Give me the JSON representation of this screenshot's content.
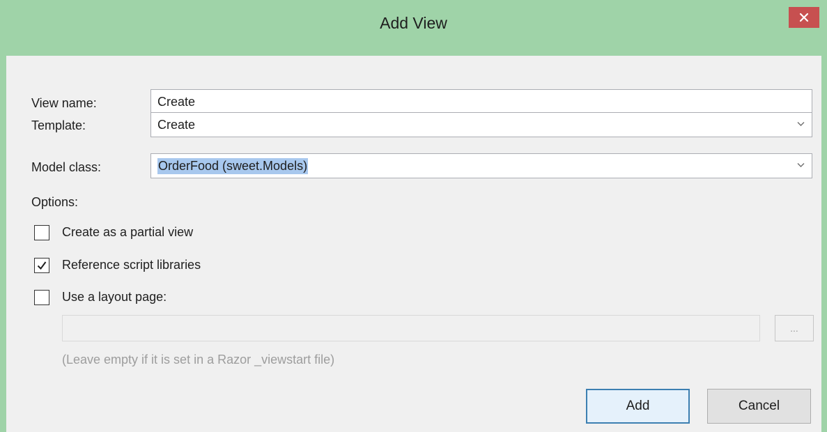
{
  "window": {
    "title": "Add View",
    "close_icon": "close-icon"
  },
  "form": {
    "view_name_label": "View name:",
    "view_name_value": "Create",
    "template_label": "Template:",
    "template_value": "Create",
    "model_class_label": "Model class:",
    "model_class_value": "OrderFood (sweet.Models)"
  },
  "options": {
    "label": "Options:",
    "partial_view": {
      "label": "Create as a partial view",
      "checked": false
    },
    "reference_scripts": {
      "label": "Reference script libraries",
      "checked": true
    },
    "layout_page": {
      "label": "Use a layout page:",
      "checked": false
    },
    "layout_path_value": "",
    "browse_label": "...",
    "hint": "(Leave empty if it is set in a Razor _viewstart file)"
  },
  "buttons": {
    "add": "Add",
    "cancel": "Cancel"
  },
  "colors": {
    "titlebar": "#9fd3a8",
    "close": "#c75050",
    "selection": "#a8c8ee",
    "default_button_border": "#3c7fb1"
  }
}
